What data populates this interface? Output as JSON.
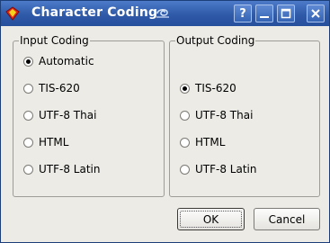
{
  "window": {
    "title": "Character Coding",
    "title_icon": "app-diamond-icon",
    "buttons": {
      "help": "?",
      "minimize": "minimize-icon",
      "maximize": "maximize-icon",
      "close": "close-icon"
    }
  },
  "input_coding": {
    "legend": "Input Coding",
    "options": [
      {
        "label": "Automatic",
        "checked": true
      },
      {
        "label": "TIS-620",
        "checked": false
      },
      {
        "label": "UTF-8 Thai",
        "checked": false
      },
      {
        "label": "HTML",
        "checked": false
      },
      {
        "label": "UTF-8 Latin",
        "checked": false
      }
    ]
  },
  "output_coding": {
    "legend": "Output Coding",
    "options": [
      {
        "label": "TIS-620",
        "checked": true
      },
      {
        "label": "UTF-8 Thai",
        "checked": false
      },
      {
        "label": "HTML",
        "checked": false
      },
      {
        "label": "UTF-8 Latin",
        "checked": false
      }
    ]
  },
  "dialog_buttons": {
    "ok": "OK",
    "cancel": "Cancel"
  },
  "colors": {
    "titlebar": "#2f5aa8",
    "title_text": "#ffffff",
    "background": "#ecebe6"
  }
}
